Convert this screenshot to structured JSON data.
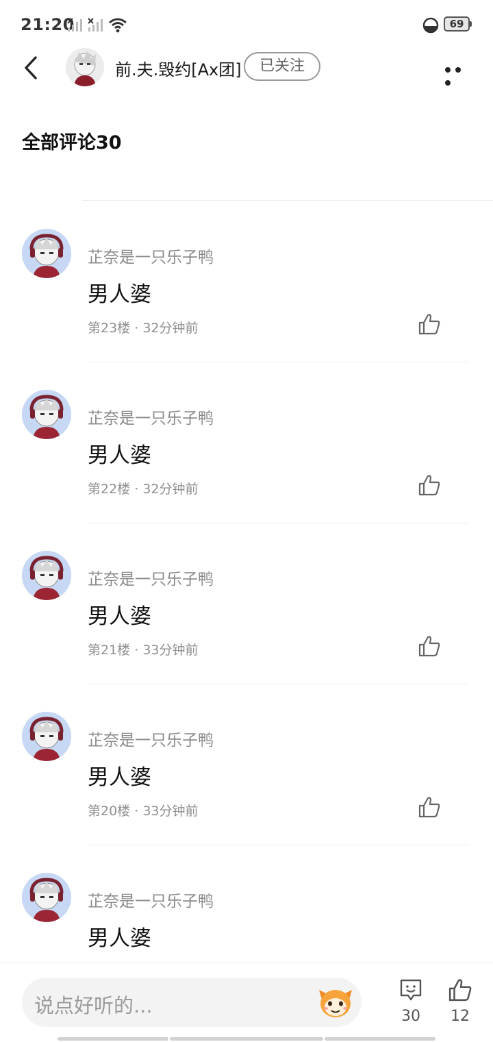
{
  "status_bar": {
    "time": "21:20",
    "battery": "69",
    "icons": [
      "signal-x-icon",
      "signal-x-icon",
      "wifi-icon",
      "battery-saver-icon",
      "battery-icon"
    ]
  },
  "header": {
    "author_name": "前.夫.毁约[Ax团]",
    "follow_label": "已关注",
    "icons": [
      "back-icon",
      "more-icon"
    ]
  },
  "section_title": "全部评论30",
  "comments": [
    {
      "user": "芷奈是一只乐子鸭",
      "text": "男人婆",
      "floor": "第23楼",
      "time": "32分钟前"
    },
    {
      "user": "芷奈是一只乐子鸭",
      "text": "男人婆",
      "floor": "第22楼",
      "time": "32分钟前"
    },
    {
      "user": "芷奈是一只乐子鸭",
      "text": "男人婆",
      "floor": "第21楼",
      "time": "33分钟前"
    },
    {
      "user": "芷奈是一只乐子鸭",
      "text": "男人婆",
      "floor": "第20楼",
      "time": "33分钟前"
    },
    {
      "user": "芷奈是一只乐子鸭",
      "text": "男人婆",
      "floor": "",
      "time": ""
    }
  ],
  "bottom_bar": {
    "input_placeholder": "说点好听的...",
    "comment_count": "30",
    "like_count": "12",
    "icons": [
      "emoji-icon",
      "comment-icon",
      "like-icon"
    ]
  },
  "colors": {
    "accent_text": "#111111",
    "muted_text": "#8a8a8a",
    "divider": "#ececec",
    "input_bg": "#f3f3f3"
  }
}
